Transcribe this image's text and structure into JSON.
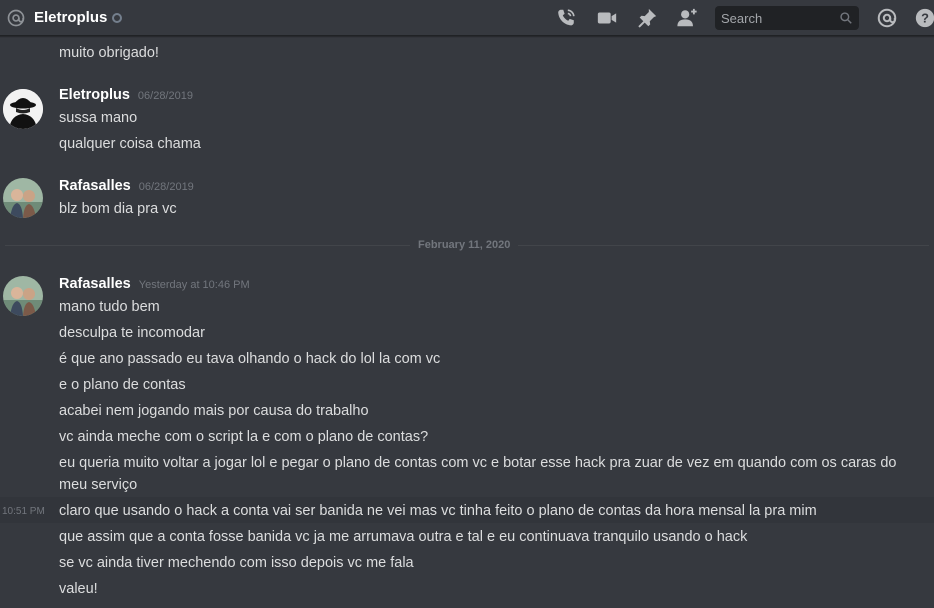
{
  "header": {
    "channel_name": "Eletroplus",
    "search_placeholder": "Search",
    "icons": [
      "at-icon",
      "call-icon",
      "video-icon",
      "pin-icon",
      "add-friend-icon",
      "search-icon",
      "mentions-icon",
      "help-icon"
    ]
  },
  "messages": {
    "top_continuation": "muito obrigado!",
    "group1": {
      "author": "Eletroplus",
      "timestamp": "06/28/2019",
      "lines": [
        "sussa mano",
        "qualquer coisa chama"
      ]
    },
    "group2": {
      "author": "Rafasalles",
      "timestamp": "06/28/2019",
      "lines": [
        "blz bom dia pra vc"
      ]
    },
    "date_divider": "February 11, 2020",
    "group3": {
      "author": "Rafasalles",
      "timestamp": "Yesterday at 10:46 PM",
      "lines": [
        "mano tudo bem",
        "desculpa te incomodar",
        "é que ano passado eu tava olhando o hack do lol la com vc",
        "e o plano de contas",
        "acabei nem jogando mais por causa do trabalho",
        "vc ainda meche com o script la e com o plano de contas?",
        "eu queria muito voltar a jogar lol e pegar o plano de contas com vc e botar esse hack pra zuar de vez em quando com os caras do",
        "meu serviço",
        "claro que usando o hack a conta vai ser banida ne vei mas vc tinha feito o plano de contas da hora mensal la pra mim",
        "que assim que a conta fosse banida vc ja me arrumava outra e tal e eu continuava tranquilo usando o hack",
        "se vc ainda tiver mechendo com isso depois vc me fala",
        "valeu!"
      ],
      "hover_timestamp": "10:51 PM"
    }
  },
  "colors": {
    "background": "#36393f",
    "text": "#dcddde",
    "muted": "#72767d",
    "username": "#ffffff"
  }
}
